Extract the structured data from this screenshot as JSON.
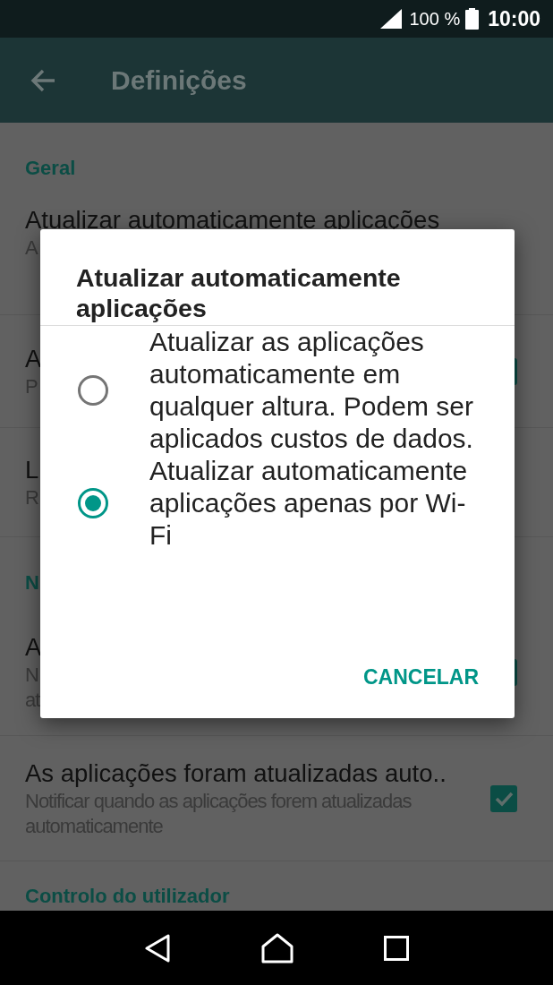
{
  "status_bar": {
    "battery_text": "100 %",
    "time": "10:00"
  },
  "app_bar": {
    "title": "Definições"
  },
  "settings": [
    {
      "kind": "header",
      "text": "Geral"
    },
    {
      "kind": "setting",
      "title": "Atualizar automaticamente aplicações",
      "summary": [
        "A"
      ]
    },
    {
      "kind": "covered-setting",
      "title": "A",
      "summary": [
        "P"
      ],
      "checked": true
    },
    {
      "kind": "setting",
      "title": "L",
      "summary": [
        "R"
      ]
    },
    {
      "kind": "header",
      "text": "N"
    },
    {
      "kind": "covered-setting",
      "title": "A",
      "summary": [
        "N",
        "at"
      ],
      "checked": true
    },
    {
      "kind": "setting",
      "title": "As aplicações foram atualizadas auto..",
      "summary": [
        "Notificar quando as aplicações forem atualizadas automaticamente"
      ],
      "checked": true
    },
    {
      "kind": "header",
      "text": "Controlo do utilizador"
    }
  ],
  "dialog": {
    "title": "Atualizar automaticamente aplicações",
    "options": [
      {
        "label": "Atualizar as aplicações automaticamente em qualquer altura. Podem ser aplicados custos de dados.",
        "selected": false
      },
      {
        "label": "Atualizar automaticamente aplicações apenas por Wi-Fi",
        "selected": true
      }
    ],
    "buttons": [
      "CANCELAR"
    ]
  }
}
